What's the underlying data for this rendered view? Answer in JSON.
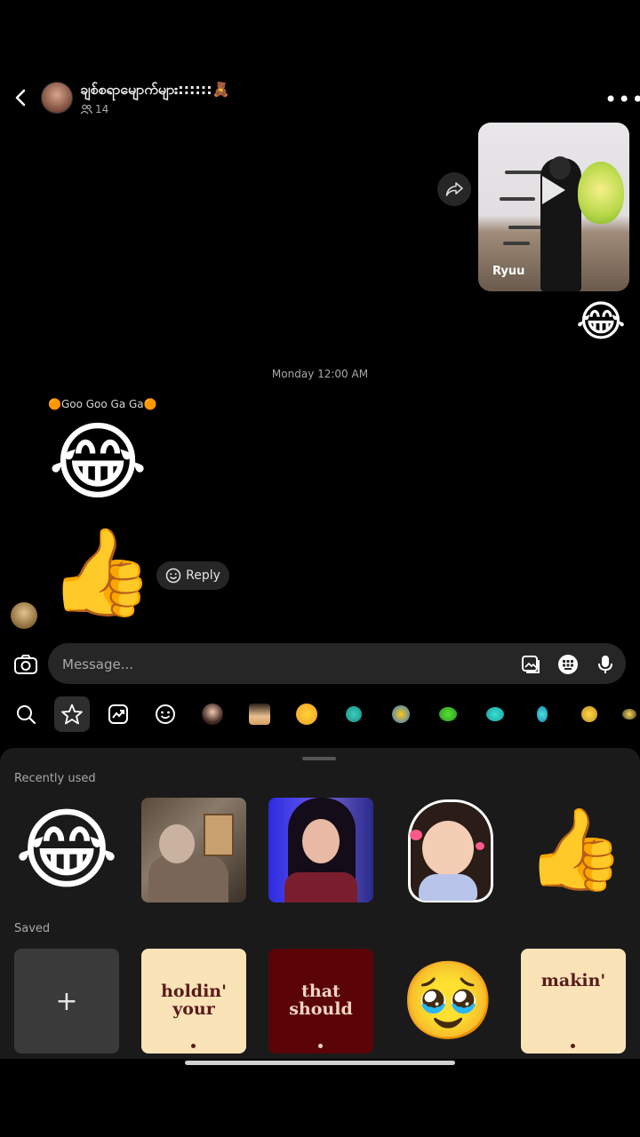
{
  "header": {
    "title": "ချစ်စရာမျောက်များ::::::🧸",
    "member_count": "14"
  },
  "messages": {
    "outgoing_video_author": "Ryuu",
    "outgoing_reaction_emoji": "😂",
    "timestamp": "Monday 12:00 AM",
    "sender_name": "🟠Goo Goo Ga Ga🟠",
    "incoming_emoji_1": "😂",
    "incoming_emoji_2": "👍",
    "reply_label": "Reply"
  },
  "composer": {
    "placeholder": "Message..."
  },
  "sticker_tabs": [
    "search",
    "favorites",
    "trending",
    "emoji",
    "avatar-1",
    "avatar-2",
    "pack-1",
    "pack-2",
    "pack-3",
    "pack-4",
    "pack-5",
    "pack-6",
    "pack-7",
    "pack-8"
  ],
  "panel": {
    "recent_title": "Recently used",
    "saved_title": "Saved",
    "recent": [
      {
        "type": "emoji",
        "value": "😂"
      },
      {
        "type": "photo",
        "value": "elderly-person"
      },
      {
        "type": "photo",
        "value": "girl-portrait"
      },
      {
        "type": "sticker",
        "value": "cartoon-girl"
      },
      {
        "type": "emoji",
        "value": "👍"
      }
    ],
    "saved": [
      {
        "type": "add",
        "value": "+"
      },
      {
        "type": "text",
        "value": "holdin' your"
      },
      {
        "type": "text",
        "value": "that should"
      },
      {
        "type": "emoji",
        "value": "🥹"
      },
      {
        "type": "text",
        "value": "makin'"
      }
    ]
  },
  "colors": {
    "background": "#000000",
    "bubble": "#262626",
    "panel": "#1a1a1a",
    "cream": "#fbe3b8",
    "maroon": "#5a0408",
    "text_maroon": "#5a1a1a"
  }
}
